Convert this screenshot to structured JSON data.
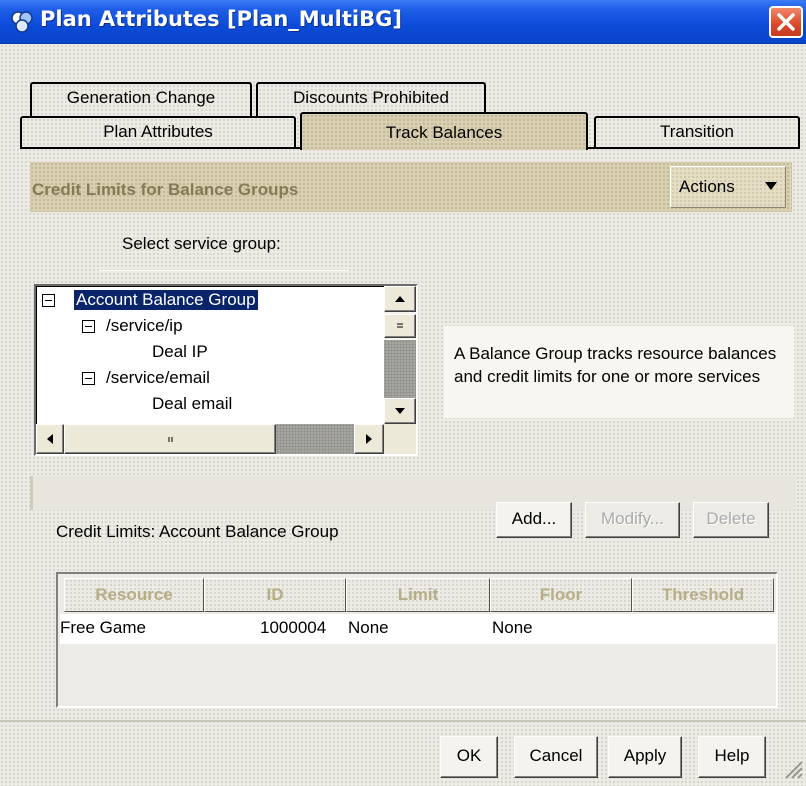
{
  "window": {
    "title": "Plan Attributes [Plan_MultiBG]"
  },
  "tabs": {
    "row1": [
      {
        "label": "Generation Change"
      },
      {
        "label": "Discounts Prohibited"
      }
    ],
    "row2": [
      {
        "label": "Plan Attributes"
      },
      {
        "label": "Track Balances",
        "active": true
      },
      {
        "label": "Transition"
      }
    ]
  },
  "section": {
    "title": "Credit Limits for Balance Groups",
    "actions_label": "Actions"
  },
  "service_group": {
    "label": "Select service group:",
    "tree": [
      {
        "label": "Account Balance Group",
        "selected": true
      },
      {
        "label": "/service/ip"
      },
      {
        "label": "Deal  IP"
      },
      {
        "label": "/service/email"
      },
      {
        "label": "Deal  email"
      }
    ]
  },
  "info": {
    "text": "A Balance Group tracks resource balances and credit limits for one or more services"
  },
  "credit_limits": {
    "label": "Credit Limits:  Account Balance Group",
    "add_label": "Add...",
    "modify_label": "Modify...",
    "delete_label": "Delete"
  },
  "table": {
    "columns": [
      "Resource",
      "ID",
      "Limit",
      "Floor",
      "Threshold"
    ],
    "rows": [
      {
        "resource": "Free Game",
        "id": "1000004",
        "limit": "None",
        "floor": "None",
        "threshold": ""
      }
    ]
  },
  "footer": {
    "ok_label": "OK",
    "cancel_label": "Cancel",
    "apply_label": "Apply",
    "help_label": "Help"
  },
  "colors": {
    "titlebar": "#0b4bd8",
    "active_tab": "#d9cfb2",
    "selection": "#0a246a",
    "section_title": "#857a55",
    "close_button": "#d9482a"
  },
  "icons": [
    "app-icon",
    "close-icon",
    "expander-minus-icon",
    "arrow-up-icon",
    "arrow-down-icon",
    "arrow-left-icon",
    "arrow-right-icon",
    "dropdown-arrow-icon",
    "resize-grip-icon"
  ]
}
